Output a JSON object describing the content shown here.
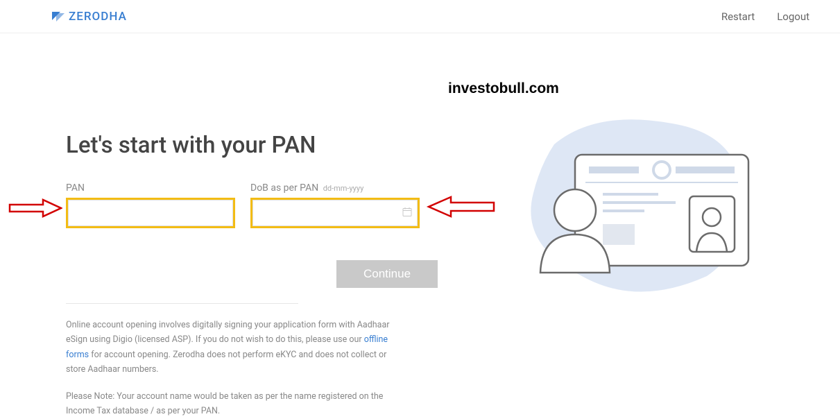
{
  "header": {
    "brand": "ZERODHA",
    "restart": "Restart",
    "logout": "Logout"
  },
  "watermark": "investobull.com",
  "form": {
    "title": "Let's start with your PAN",
    "pan_label": "PAN",
    "pan_value": "",
    "dob_label": "DoB as per PAN",
    "dob_hint": "dd-mm-yyyy",
    "dob_value": "",
    "continue_label": "Continue"
  },
  "info": {
    "para1_a": "Online account opening involves digitally signing your application form with Aadhaar eSign using Digio (licensed ASP). If you do not wish to do this, please use our ",
    "link": "offline forms",
    "para1_b": " for account opening. Zerodha does not perform eKYC and does not collect or store Aadhaar numbers.",
    "para2": "Please Note: Your account name would be taken as per the name registered on the Income Tax database / as per your PAN."
  }
}
